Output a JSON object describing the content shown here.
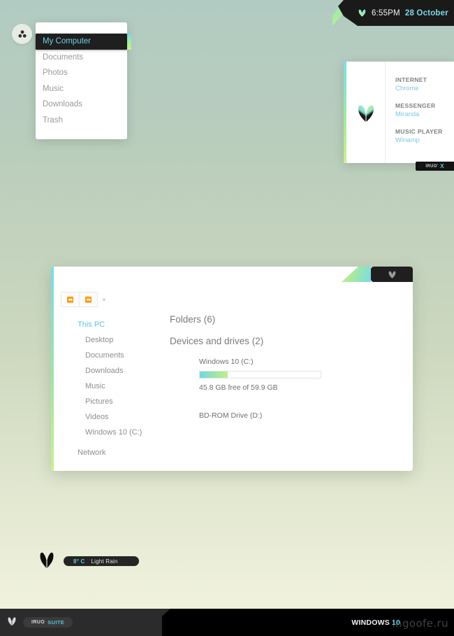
{
  "theme": {
    "name": "IRUO SUITE",
    "accent_cyan": "#6fd3e2",
    "accent_green": "#cdf08c",
    "dark": "#1f1f1f",
    "bg_top": "#b2cbc2",
    "bg_bottom": "#f0f1dd"
  },
  "clock": {
    "time": "6:55PM",
    "date": "28 October",
    "logo_icon": "butterfly-logo-icon"
  },
  "start_menu": {
    "avatar_icon": "trefoil-avatar-icon",
    "items": [
      {
        "label": "My Computer",
        "selected": true
      },
      {
        "label": "Documents",
        "selected": false
      },
      {
        "label": "Photos",
        "selected": false
      },
      {
        "label": "Music",
        "selected": false
      },
      {
        "label": "Downloads",
        "selected": false
      },
      {
        "label": "Trash",
        "selected": false
      }
    ]
  },
  "programs_panel": {
    "logo_icon": "butterfly-logo-icon",
    "entries": [
      {
        "category": "INTERNET",
        "app": "Chrome"
      },
      {
        "category": "MESSENGER",
        "app": "Miranda"
      },
      {
        "category": "MUSIC PLAYER",
        "app": "Winamp"
      }
    ],
    "badge": {
      "text": "IRUO'",
      "mark": "X"
    }
  },
  "explorer": {
    "logo_icon": "butterfly-logo-icon",
    "nav": {
      "back_icon": "back-arrow-icon",
      "forward_icon": "forward-arrow-icon",
      "dropdown_icon": "chevron-down-icon"
    },
    "sidebar": {
      "root": "This PC",
      "items": [
        "Desktop",
        "Documents",
        "Downloads",
        "Music",
        "Pictures",
        "Videos",
        "Windows 10 (C:)"
      ],
      "network": "Network"
    },
    "content": {
      "folders_heading": "Folders (6)",
      "devices_heading": "Devices and drives (2)",
      "drives": [
        {
          "name": "Windows 10 (C:)",
          "free_text": "45.8 GB free of 59.9 GB",
          "used_percent": 23,
          "has_bar": true
        },
        {
          "name": "BD-ROM Drive (D:)",
          "free_text": "",
          "used_percent": 0,
          "has_bar": false
        }
      ]
    }
  },
  "weather": {
    "logo_icon": "butterfly-logo-icon",
    "temperature": "8° C",
    "condition": "Light Rain"
  },
  "taskbar": {
    "logo_icon": "butterfly-logo-icon",
    "suite_word1": "IRUO",
    "suite_word2": "SUITE",
    "brand_word1": "WINDOWS",
    "brand_word2": "10",
    "watermark": "ingoofe.ru"
  }
}
